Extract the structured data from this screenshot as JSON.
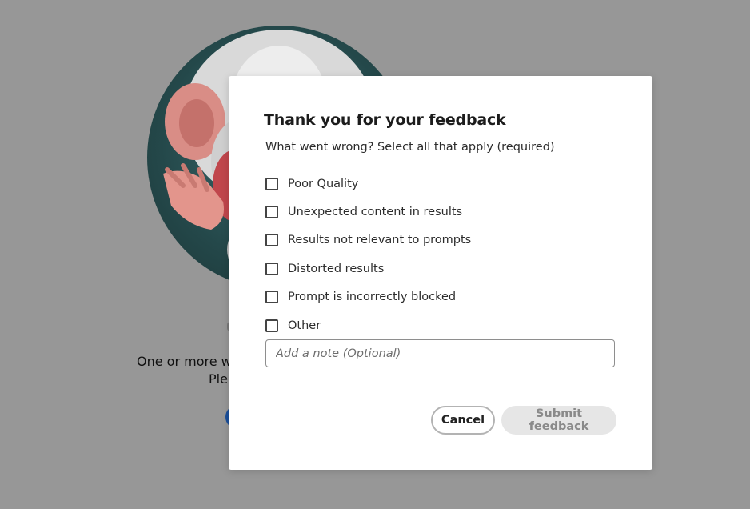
{
  "background": {
    "error_line1": "One or more wo",
    "error_line2": "Plea"
  },
  "dialog": {
    "title": "Thank you for your feedback",
    "subtitle": "What went wrong? Select all that apply (required)",
    "options": [
      {
        "label": "Poor Quality",
        "checked": false
      },
      {
        "label": "Unexpected content in results",
        "checked": false
      },
      {
        "label": "Results not relevant to prompts",
        "checked": false
      },
      {
        "label": "Distorted results",
        "checked": false
      },
      {
        "label": "Prompt is incorrectly blocked",
        "checked": false
      },
      {
        "label": "Other",
        "checked": false
      }
    ],
    "note": {
      "placeholder": "Add a note (Optional)",
      "value": ""
    },
    "cancel_label": "Cancel",
    "submit_label": "Submit feedback"
  },
  "colors": {
    "overlay": "#979797",
    "dialog_bg": "#ffffff",
    "submit_disabled_bg": "#e6e6e6",
    "submit_disabled_text": "#8a8a8a"
  }
}
